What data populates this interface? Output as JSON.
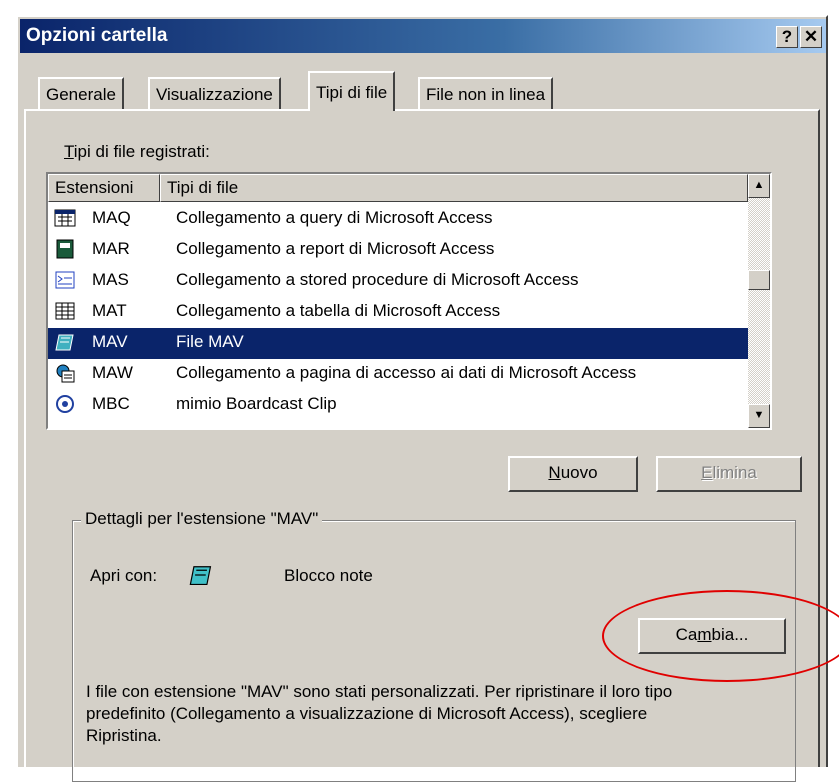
{
  "window": {
    "title": "Opzioni cartella",
    "help_btn": "?",
    "close_btn": "✕"
  },
  "tabs": [
    "Generale",
    "Visualizzazione",
    "Tipi di file",
    "File non in linea"
  ],
  "registered": {
    "label_first": "T",
    "label_rest": "ipi di file registrati:",
    "columns": [
      "Estensioni",
      "Tipi di file"
    ],
    "rows": [
      {
        "ext": "MAQ",
        "desc": "Collegamento a query di Microsoft Access",
        "icon": "query-icon"
      },
      {
        "ext": "MAR",
        "desc": "Collegamento a report di Microsoft Access",
        "icon": "report-icon"
      },
      {
        "ext": "MAS",
        "desc": "Collegamento a stored procedure di Microsoft Access",
        "icon": "stored-procedure-icon"
      },
      {
        "ext": "MAT",
        "desc": "Collegamento a tabella di Microsoft Access",
        "icon": "table-icon"
      },
      {
        "ext": "MAV",
        "desc": "File MAV",
        "icon": "notepad-icon",
        "selected": true
      },
      {
        "ext": "MAW",
        "desc": "Collegamento a pagina di accesso ai dati di Microsoft Access",
        "icon": "data-page-icon"
      },
      {
        "ext": "MBC",
        "desc": "mimio Boardcast Clip",
        "icon": "mimio-icon"
      }
    ]
  },
  "buttons": {
    "new_first": "N",
    "new_rest": "uovo",
    "delete_first": "E",
    "delete_rest": "limina",
    "change_pre": "Ca",
    "change_u": "m",
    "change_post": "bia..."
  },
  "details": {
    "title": "Dettagli per l'estensione \"MAV\"",
    "open_with_label": "Apri con:",
    "open_with_app": "Blocco note",
    "note_line1": "I file con estensione \"MAV\" sono stati personalizzati. Per ripristinare il loro tipo",
    "note_line2": "predefinito (Collegamento a visualizzazione di Microsoft Access), scegliere",
    "note_line3": "Ripristina."
  },
  "colors": {
    "selection": "#0a246a",
    "annotation_circle": "#e00000"
  }
}
